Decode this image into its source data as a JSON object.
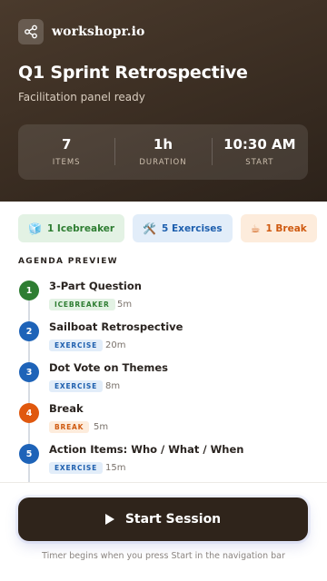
{
  "brand": {
    "name": "workshopr.io",
    "icon": "share-nodes-icon"
  },
  "header": {
    "title": "Q1 Sprint Retrospective",
    "subtitle": "Facilitation panel ready"
  },
  "stats": [
    {
      "value": "7",
      "label": "ITEMS"
    },
    {
      "value": "1h",
      "label": "DURATION"
    },
    {
      "value": "10:30 AM",
      "label": "START"
    }
  ],
  "chips": [
    {
      "icon": "🧊",
      "label": "1 Icebreaker",
      "kind": "icebreaker"
    },
    {
      "icon": "🛠️",
      "label": "5 Exercises",
      "kind": "exercise"
    },
    {
      "icon": "☕",
      "label": "1 Break",
      "kind": "break"
    }
  ],
  "agenda": {
    "section_title": "AGENDA PREVIEW",
    "items": [
      {
        "number": "1",
        "title": "3-Part Question",
        "tag": "ICEBREAKER",
        "duration": "5m",
        "kind": "icebreaker"
      },
      {
        "number": "2",
        "title": "Sailboat Retrospective",
        "tag": "EXERCISE",
        "duration": "20m",
        "kind": "exercise"
      },
      {
        "number": "3",
        "title": "Dot Vote on Themes",
        "tag": "EXERCISE",
        "duration": "8m",
        "kind": "exercise"
      },
      {
        "number": "4",
        "title": "Break",
        "tag": "BREAK",
        "duration": "5m",
        "kind": "break"
      },
      {
        "number": "5",
        "title": "Action Items: Who / What / When",
        "tag": "EXERCISE",
        "duration": "15m",
        "kind": "exercise"
      }
    ]
  },
  "footer": {
    "start_label": "Start Session",
    "note": "Timer begins when you press Start in the navigation bar"
  },
  "colors": {
    "hero": "#3a2d22",
    "icebreaker": "#2e7d32",
    "exercise": "#1e63b8",
    "break": "#e0580e",
    "button": "#2f241b"
  }
}
